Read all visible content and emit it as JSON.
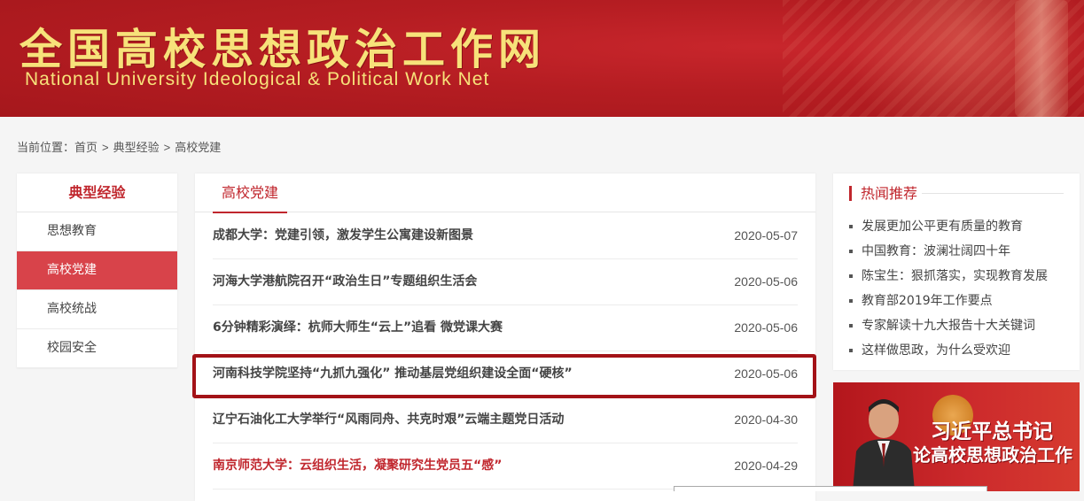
{
  "header": {
    "title": "全国高校思想政治工作网",
    "subtitle": "National University Ideological & Political Work Net"
  },
  "breadcrumb": {
    "prefix": "当前位置：",
    "items": [
      "首页",
      "典型经验",
      "高校党建"
    ],
    "separator": ">"
  },
  "sidebar": {
    "heading": "典型经验",
    "items": [
      {
        "label": "思想教育",
        "active": false
      },
      {
        "label": "高校党建",
        "active": true
      },
      {
        "label": "高校统战",
        "active": false
      },
      {
        "label": "校园安全",
        "active": false
      }
    ]
  },
  "main": {
    "tab": "高校党建",
    "articles": [
      {
        "title": "成都大学：党建引领，激发学生公寓建设新图景",
        "date": "2020-05-07"
      },
      {
        "title": "河海大学港航院召开“政治生日”专题组织生活会",
        "date": "2020-05-06"
      },
      {
        "title": "6分钟精彩演绎：杭师大师生“云上”追看 微党课大赛",
        "date": "2020-05-06"
      },
      {
        "title": "河南科技学院坚持“九抓九强化” 推动基层党组织建设全面“硬核”",
        "date": "2020-05-06"
      },
      {
        "title": "辽宁石油化工大学举行“风雨同舟、共克时艰”云端主题党日活动",
        "date": "2020-04-30"
      },
      {
        "title": "南京师范大学：云组织生活，凝聚研究生党员五“感”",
        "date": "2020-04-29"
      }
    ]
  },
  "hot": {
    "heading": "热闻推荐",
    "items": [
      "发展更加公平更有质量的教育",
      "中国教育：波澜壮阔四十年",
      "陈宝生：狠抓落实，实现教育发展",
      "教育部2019年工作要点",
      "专家解读十九大报告十大关键词",
      "这样做思政，为什么受欢迎"
    ]
  },
  "promo": {
    "line1": "习近平总书记",
    "line2": "论高校思想政治工作"
  },
  "colors": {
    "brand_red": "#c0262d",
    "active_bg": "#d8434a",
    "title_gold": "#f7e27a",
    "highlight_border": "#a31217"
  }
}
